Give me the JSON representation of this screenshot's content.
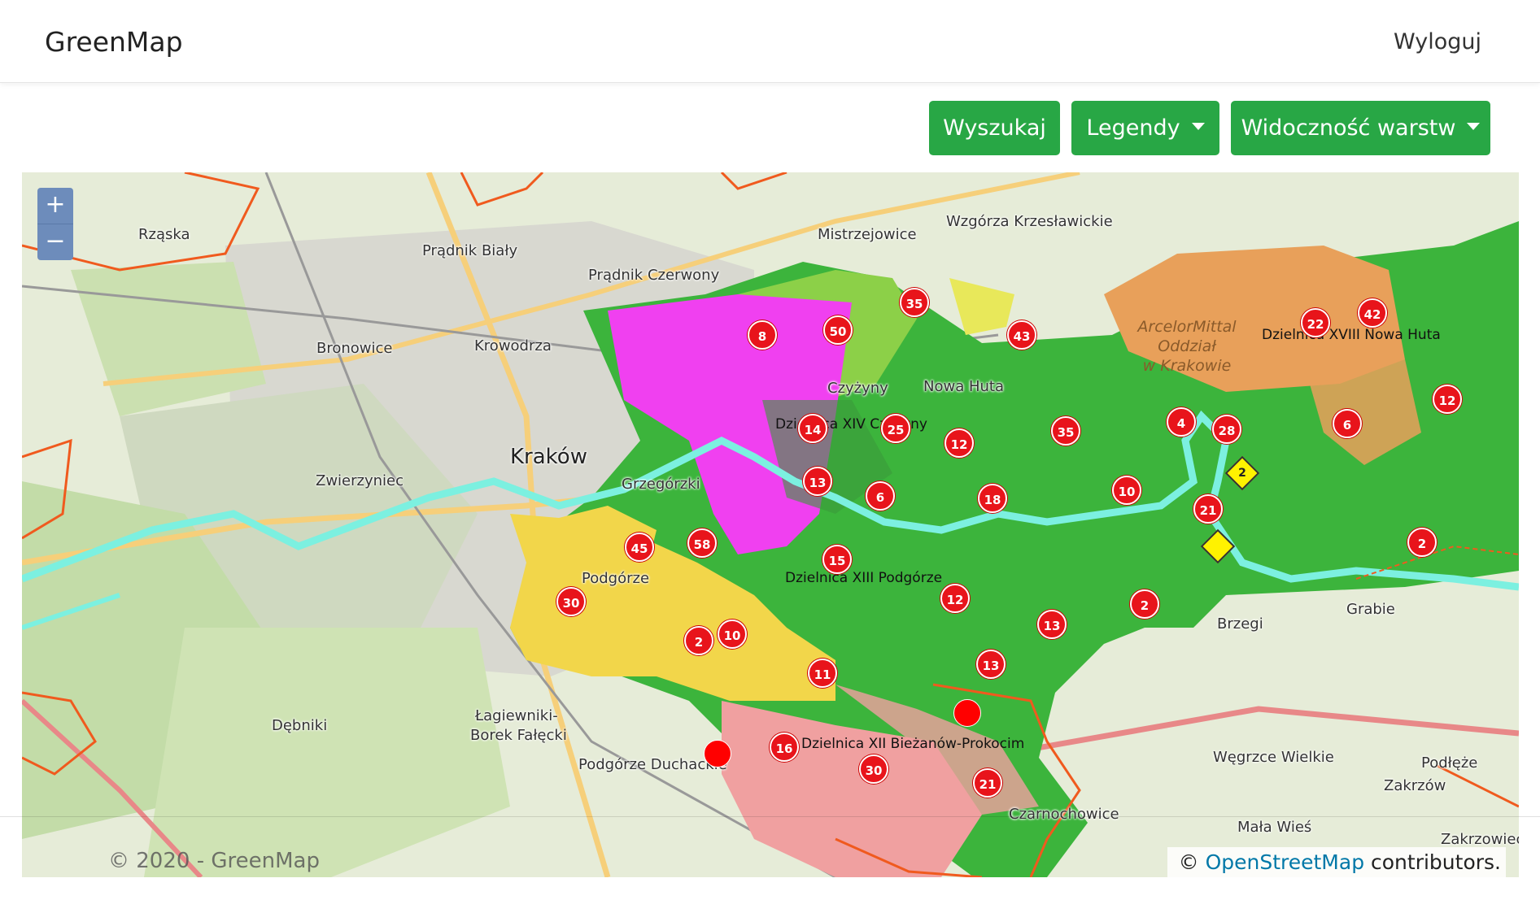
{
  "navbar": {
    "brand": "GreenMap",
    "logout_label": "Wyloguj"
  },
  "toolbar": {
    "search_label": "Wyszukaj",
    "legend_label": "Legendy",
    "layers_label": "Widoczność warstw",
    "button_color": "#28a745"
  },
  "map": {
    "zoom_in": "+",
    "zoom_out": "−",
    "places": {
      "rzaska": "Rząska",
      "pradnik_bialy": "Prądnik Biały",
      "mistrzejowice": "Mistrzejowice",
      "wzgorza": "Wzgórza Krzesławickie",
      "pradnik_czerwony": "Prądnik Czerwony",
      "bronowice": "Bronowice",
      "krowodrza": "Krowodrza",
      "krakow": "Kraków",
      "zwierzyniec": "Zwierzyniec",
      "grzegorzki": "Grzegórzki",
      "czyzyny": "Czyżyny",
      "nowa_huta": "Nowa Huta",
      "podgorze": "Podgórze",
      "lagiewniki": "Łagiewniki-",
      "borek": "Borek Fałęcki",
      "debniki": "Dębniki",
      "podgorze_duchackie": "Podgórze Duchackie",
      "brzegi": "Brzegi",
      "grabie": "Grabie",
      "wegrzce": "Węgrzce Wielkie",
      "podleze": "Podłęże",
      "zakrzow": "Zakrzów",
      "mala_wies": "Mała Wieś",
      "czarnochowice": "Czarnochowice",
      "zakrzowiec": "Zakrzowiec",
      "steel1": "ArcelorMittal",
      "steel2": "Oddział",
      "steel3": "w Krakowie"
    },
    "districts": {
      "d14": "Dzielnica XIV Czyżyny",
      "d13": "Dzielnica XIII Podgórze",
      "d12": "Dzielnica XII Bieżanów-Prokocim",
      "d18": "Dzielnica XVIII Nowa Huta"
    },
    "colors": {
      "green": "#3cb43c",
      "magenta": "#f040f0",
      "yellow": "#f2d64a",
      "pink": "#f0a0a0",
      "orange": "#e8a05a",
      "river": "#7cf0e0",
      "marker": "#e8141b",
      "boundary": "#f05a1e"
    },
    "markers": [
      "35",
      "50",
      "8",
      "43",
      "14",
      "25",
      "12",
      "35",
      "4",
      "28",
      "22",
      "42",
      "12",
      "6",
      "13",
      "6",
      "18",
      "10",
      "21",
      "2",
      "45",
      "58",
      "15",
      "30",
      "12",
      "13",
      "2",
      "10",
      "11",
      "13",
      "16",
      "30",
      "21",
      "2"
    ],
    "diamond_label": "2",
    "attribution_prefix": "©",
    "attribution_link": "OpenStreetMap",
    "attribution_suffix": "contributors."
  },
  "footer": {
    "copyright": "© 2020 - GreenMap"
  }
}
